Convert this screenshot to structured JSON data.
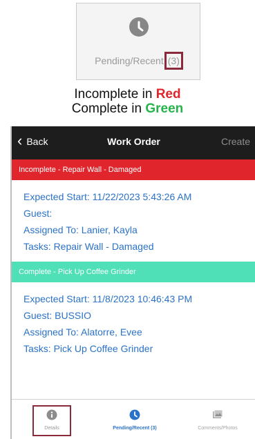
{
  "tile": {
    "icon": "clock-icon",
    "label": "Pending/Recent",
    "count": "(3)"
  },
  "caption": {
    "line1_prefix": "Incomplete in ",
    "line1_color_word": "Red",
    "line2_prefix": "Complete in ",
    "line2_color_word": "Green"
  },
  "colors": {
    "incomplete": "#e0262c",
    "complete": "#4fe0b7",
    "link_text": "#2a72c7",
    "highlight_outline": "#8a2a3b"
  },
  "nav": {
    "back_label": "Back",
    "title": "Work Order",
    "create_label": "Create"
  },
  "orders": [
    {
      "header": "Incomplete - Repair Wall - Damaged",
      "status": "incomplete",
      "expected_start": "Expected Start: 11/22/2023 5:43:26 AM",
      "guest": "Guest:",
      "assigned_to": "Assigned To: Lanier, Kayla",
      "tasks": "Tasks: Repair Wall - Damaged"
    },
    {
      "header": "Complete - Pick Up Coffee Grinder",
      "status": "complete",
      "expected_start": "Expected Start: 11/8/2023 10:46:43 PM",
      "guest": "Guest: BUSSIO",
      "assigned_to": "Assigned To: Alatorre, Evee",
      "tasks": "Tasks: Pick Up Coffee Grinder"
    }
  ],
  "tabs": [
    {
      "label": "Details",
      "icon": "info-icon"
    },
    {
      "label": "Pending/Recent (3)",
      "icon": "clock-icon"
    },
    {
      "label": "Comments/Photos",
      "icon": "photos-icon"
    }
  ]
}
